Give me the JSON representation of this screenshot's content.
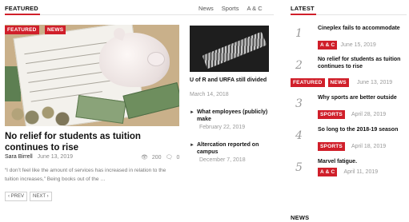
{
  "featured": {
    "heading": "FEATURED",
    "nav": [
      "News",
      "Sports",
      "A & C"
    ],
    "main": {
      "tags": [
        "FEATURED",
        "NEWS"
      ],
      "title": "No relief for students as tuition continues to rise",
      "author": "Sara Birrell",
      "date": "June 13, 2019",
      "views": "200",
      "comments": "0",
      "excerpt": "“I don’t feel like the amount of services has increased in relation to the tuition increases,” Being books out of the …",
      "prev_label": "‹ PREV",
      "next_label": "NEXT ›"
    },
    "side": {
      "title": "U of R and URFA still divided",
      "date": "March 14, 2018",
      "items": [
        {
          "title": "What employees (publicly) make",
          "date": "February 22, 2019"
        },
        {
          "title": "Altercation reported on campus",
          "date": "December 7, 2018"
        }
      ]
    }
  },
  "latest": {
    "heading": "LATEST",
    "items": [
      {
        "num": "1",
        "title": "Cineplex fails to accommodate",
        "tags": [
          "A & C"
        ],
        "date": "June 15, 2019"
      },
      {
        "num": "2",
        "title": "No relief for students as tuition continues to rise",
        "tags": [
          "FEATURED",
          "NEWS"
        ],
        "date": "June 13, 2019"
      },
      {
        "num": "3",
        "title": "Why sports are better outside",
        "tags": [
          "SPORTS"
        ],
        "date": "April 28, 2019"
      },
      {
        "num": "4",
        "title": "So long to the 2018-19 season",
        "tags": [
          "SPORTS"
        ],
        "date": "April 18, 2019"
      },
      {
        "num": "5",
        "title": "Marvel fatigue.",
        "tags": [
          "A & C"
        ],
        "date": "April 11, 2019"
      }
    ]
  },
  "news": {
    "heading": "NEWS"
  },
  "colors": {
    "accent": "#d01f2a",
    "muted": "#999999"
  }
}
